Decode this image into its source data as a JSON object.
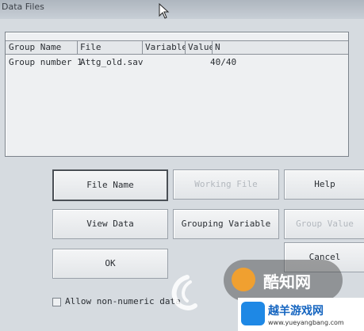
{
  "window": {
    "title": "Data Files"
  },
  "grid": {
    "columns": [
      "Group Name",
      "File",
      "Variable",
      "Value",
      "N"
    ],
    "rows": [
      {
        "group_name": "Group number 1",
        "file": "Attg_old.sav",
        "variable": "",
        "value": "",
        "n": "40/40"
      }
    ]
  },
  "buttons": {
    "file_name": "File Name",
    "working_file": "Working File",
    "help": "Help",
    "view_data": "View Data",
    "grouping_variable": "Grouping Variable",
    "group_value": "Group Value",
    "ok": "OK",
    "cancel": "Cancel"
  },
  "options": {
    "allow_non_numeric_label": "Allow non-numeric data",
    "allow_non_numeric_checked": false
  },
  "watermarks": {
    "brand1": "酷知网",
    "brand2": "越羊游戏网",
    "brand2_url": "www.yueyangbang.com"
  }
}
